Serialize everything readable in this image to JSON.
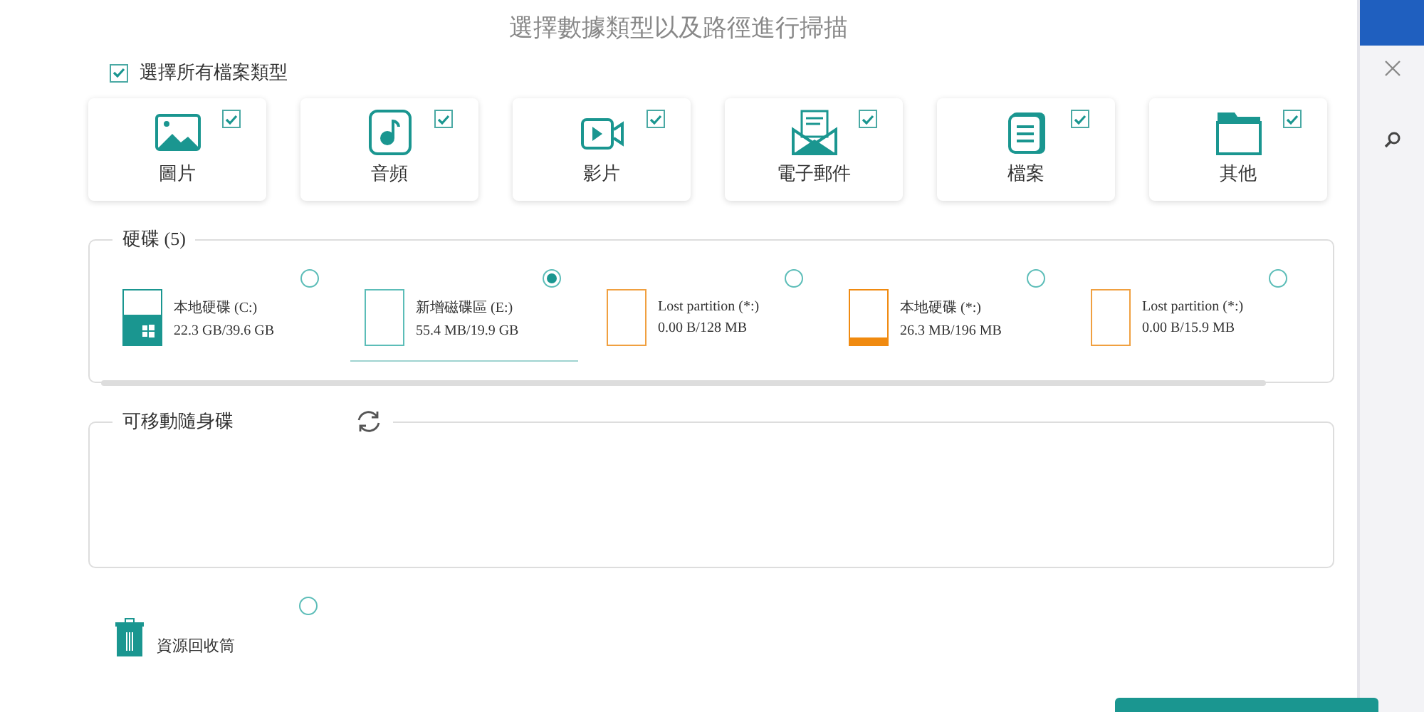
{
  "title": "選擇數據類型以及路徑進行掃描",
  "select_all": {
    "label": "選擇所有檔案類型",
    "checked": true
  },
  "categories": [
    {
      "kind": "image",
      "label": "圖片",
      "checked": true
    },
    {
      "kind": "audio",
      "label": "音頻",
      "checked": true
    },
    {
      "kind": "video",
      "label": "影片",
      "checked": true
    },
    {
      "kind": "email",
      "label": "電子郵件",
      "checked": true
    },
    {
      "kind": "document",
      "label": "檔案",
      "checked": true
    },
    {
      "kind": "other",
      "label": "其他",
      "checked": true
    }
  ],
  "drives_section": {
    "legend": "硬碟 (5)",
    "drives": [
      {
        "kind": "system",
        "name": "本地硬碟 (C:)",
        "usage": "22.3 GB/39.6 GB",
        "level": 0.56,
        "selected": false
      },
      {
        "kind": "normal",
        "name": "新增磁碟區 (E:)",
        "usage": "55.4 MB/19.9 GB",
        "selected": true
      },
      {
        "kind": "lost",
        "name": "Lost partition (*:)",
        "usage": "0.00  B/128 MB",
        "selected": false
      },
      {
        "kind": "local",
        "name": "本地硬碟 (*:)",
        "usage": "26.3 MB/196 MB",
        "level": 0.13,
        "selected": false
      },
      {
        "kind": "lost",
        "name": "Lost partition (*:)",
        "usage": "0.00  B/15.9 MB",
        "selected": false
      }
    ]
  },
  "removable_section": {
    "legend": "可移動隨身碟"
  },
  "recycle_bin": {
    "label": "資源回收筒",
    "selected": false
  }
}
